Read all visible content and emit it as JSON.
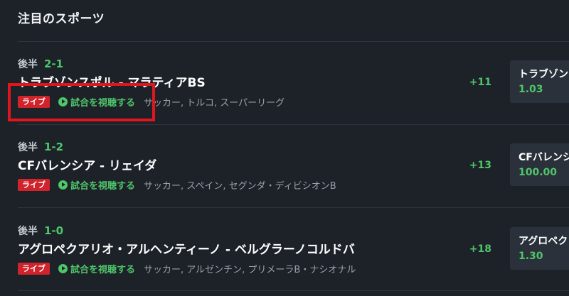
{
  "header": {
    "title": "注目のスポーツ"
  },
  "matches": [
    {
      "period": "後半",
      "score": "2-1",
      "teams": "トラブゾンスポル - マラティアBS",
      "live_label": "ライブ",
      "watch_label": "試合を視聴する",
      "league": "サッカー, トルコ, スーパーリーグ",
      "more_markets": "+11",
      "odds_name": "トラブゾン",
      "odds_value": "1.03"
    },
    {
      "period": "後半",
      "score": "1-2",
      "teams": "CFバレンシア - リェイダ",
      "live_label": "ライブ",
      "watch_label": "試合を視聴する",
      "league": "サッカー, スペイン, セグンダ・ディビシオンB",
      "more_markets": "+13",
      "odds_name": "CFバレンシ",
      "odds_value": "100.00"
    },
    {
      "period": "後半",
      "score": "1-0",
      "teams": "アグロペクアリオ・アルヘンティーノ - ベルグラーノコルドバ",
      "live_label": "ライブ",
      "watch_label": "試合を視聴する",
      "league": "サッカー, アルゼンチン, プリメーラB・ナシオナル",
      "more_markets": "+18",
      "odds_name": "アグロペク",
      "odds_value": "1.30"
    }
  ],
  "colors": {
    "background": "#1d2229",
    "accent_green": "#4fc66a",
    "live_red": "#d0232b",
    "highlight_red": "#e0161e",
    "card_bg": "#2b313a"
  },
  "icons": {
    "watch": "play-circle-icon"
  }
}
